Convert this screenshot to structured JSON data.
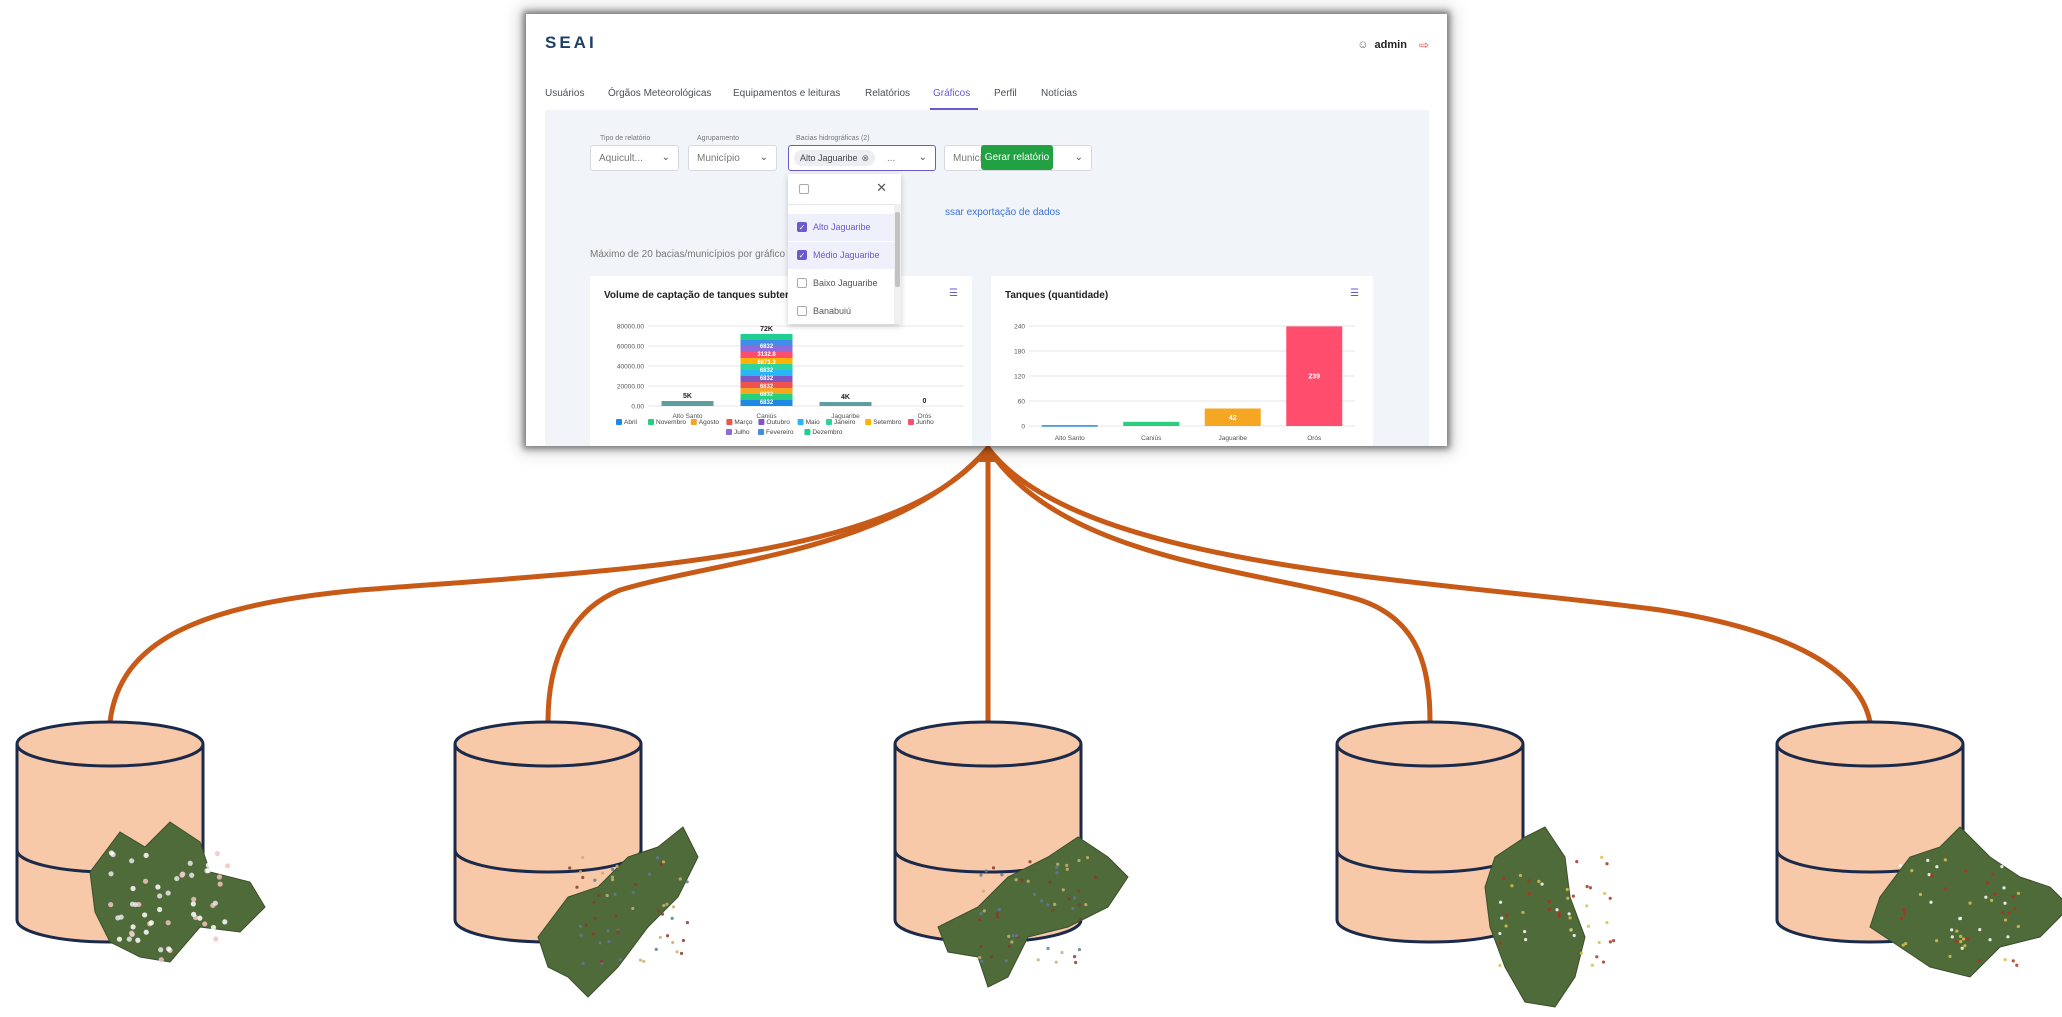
{
  "app": {
    "logo": "SEAI",
    "user": "admin",
    "nav": [
      "Usuários",
      "Órgãos Meteorológicas",
      "Equipamentos e leituras",
      "Relatórios",
      "Gráficos",
      "Perfil",
      "Notícias"
    ],
    "active_tab": "Gráficos",
    "filters": {
      "report_type": {
        "label": "Tipo de relatório",
        "value": "Aquicult..."
      },
      "grouping": {
        "label": "Agrupamento",
        "value": "Município"
      },
      "basins": {
        "label": "Bacias hidrográficas (2)",
        "chip": "Alto Jaguaribe",
        "ellipsis": "..."
      },
      "municipalities": {
        "placeholder": "Municípios"
      }
    },
    "generate_button": "Gerar relatório",
    "export_link": "ssar exportação de dados",
    "max_note": "Máximo de 20 bacias/municípios por gráfico",
    "dropdown": {
      "items": [
        {
          "label": "Alto Jaguaribe",
          "checked": true
        },
        {
          "label": "Médio Jaguaribe",
          "checked": true
        },
        {
          "label": "Baixo Jaguaribe",
          "checked": false
        },
        {
          "label": "Banabuiú",
          "checked": false
        }
      ]
    }
  },
  "chart_data": [
    {
      "type": "bar",
      "stacked": true,
      "title": "Volume de captação de tanques subterrâ",
      "categories": [
        "Alto Santo",
        "Caniús",
        "Jaguaribe",
        "Orós"
      ],
      "yticks": [
        "80000.00",
        "60000.00",
        "40000.00",
        "20000.00",
        "0.00"
      ],
      "ylim": [
        0,
        80000
      ],
      "totals": [
        "5K",
        "72K",
        "4K",
        "0"
      ],
      "segment_labels": [
        "6832",
        "6832",
        "6832",
        "6832",
        "6832",
        "6871.3",
        "3132.8",
        "6832"
      ],
      "legend": [
        "Abril",
        "Novembro",
        "Agosto",
        "Março",
        "Outubro",
        "Maio",
        "Janeiro",
        "Setembro",
        "Junho",
        "Julho",
        "Fevereiro",
        "Dezembro"
      ],
      "legend_colors": [
        "#1e88e5",
        "#26d07c",
        "#f5a623",
        "#ef5350",
        "#7e57c2",
        "#29b6f6",
        "#2ed4a0",
        "#ffb300",
        "#ff4d6d",
        "#8e6bd8",
        "#3f8ee8",
        "#1fcf8f"
      ],
      "approx_values": {
        "Alto Santo": 5000,
        "Caniús": 72000,
        "Jaguaribe": 4000,
        "Orós": 0
      }
    },
    {
      "type": "bar",
      "title": "Tanques (quantidade)",
      "categories": [
        "Alto Santo",
        "Caniús",
        "Jaguaribe",
        "Orós"
      ],
      "values": [
        2,
        10,
        42,
        239
      ],
      "data_labels": [
        "",
        "",
        "42",
        "239"
      ],
      "colors": [
        "#1e88e5",
        "#26d07c",
        "#f5a623",
        "#ff4d6d"
      ],
      "yticks": [
        "240",
        "180",
        "120",
        "60",
        "0"
      ],
      "ylim": [
        0,
        240
      ]
    }
  ],
  "diagram": {
    "database_count": 5,
    "connector_color": "#c85a17",
    "database_fill": "#f8c9a8",
    "database_stroke": "#1b2a4a"
  }
}
